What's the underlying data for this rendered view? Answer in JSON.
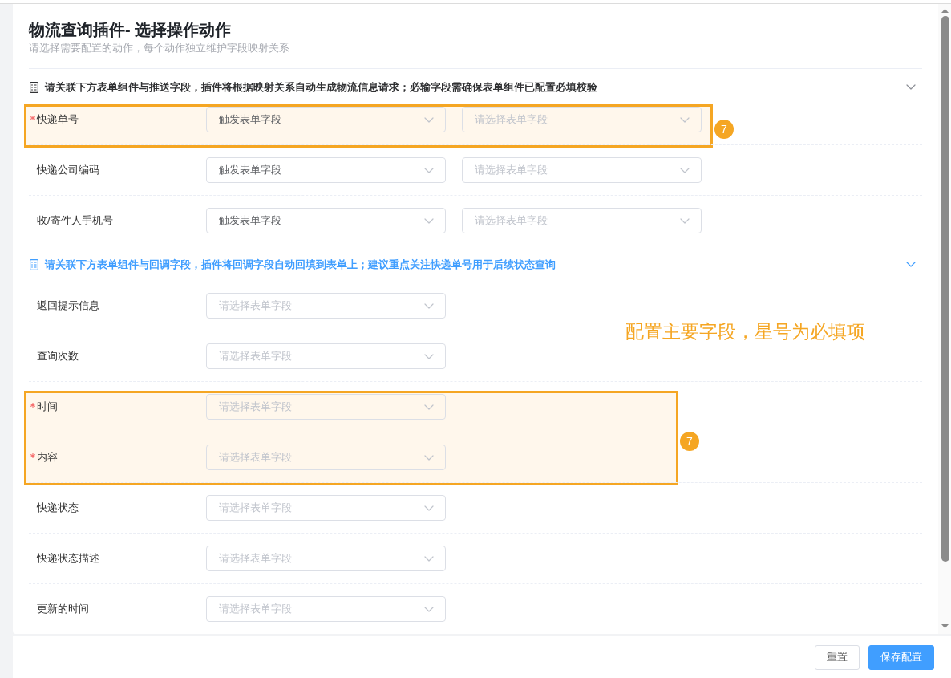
{
  "page": {
    "title": "物流查询插件- 选择操作动作",
    "subtitle": "请选择需要配置的动作，每个动作独立维护字段映射关系"
  },
  "sections": [
    {
      "title": "请关联下方表单组件与推送字段，插件将根据映射关系自动生成物流信息请求；必输字段需确保表单组件已配置必填校验",
      "active": false,
      "expanded": true,
      "badge": "7",
      "rows": [
        {
          "label": "快递单号",
          "required": true,
          "highlighted": true,
          "selects": [
            {
              "value": "触发表单字段"
            },
            {
              "placeholder": "请选择表单字段"
            }
          ]
        },
        {
          "label": "快递公司编码",
          "required": false,
          "highlighted": false,
          "selects": [
            {
              "value": "触发表单字段"
            },
            {
              "placeholder": "请选择表单字段"
            }
          ]
        },
        {
          "label": "收/寄件人手机号",
          "required": false,
          "highlighted": false,
          "selects": [
            {
              "value": "触发表单字段"
            },
            {
              "placeholder": "请选择表单字段"
            }
          ]
        }
      ]
    },
    {
      "title": "请关联下方表单组件与回调字段，插件将回调字段自动回填到表单上；建议重点关注快递单号用于后续状态查询",
      "active": true,
      "expanded": true,
      "badge": "7",
      "rows": [
        {
          "label": "返回提示信息",
          "required": false,
          "highlighted": false,
          "selects": [
            {
              "placeholder": "请选择表单字段"
            }
          ]
        },
        {
          "label": "查询次数",
          "required": false,
          "highlighted": false,
          "selects": [
            {
              "placeholder": "请选择表单字段"
            }
          ]
        },
        {
          "label": "时间",
          "required": true,
          "highlighted": true,
          "selects": [
            {
              "placeholder": "请选择表单字段"
            }
          ]
        },
        {
          "label": "内容",
          "required": true,
          "highlighted": true,
          "selects": [
            {
              "placeholder": "请选择表单字段"
            }
          ]
        },
        {
          "label": "快递状态",
          "required": false,
          "highlighted": false,
          "selects": [
            {
              "placeholder": "请选择表单字段"
            }
          ]
        },
        {
          "label": "快递状态描述",
          "required": false,
          "highlighted": false,
          "selects": [
            {
              "placeholder": "请选择表单字段"
            }
          ]
        },
        {
          "label": "更新的时间",
          "required": false,
          "highlighted": false,
          "selects": [
            {
              "placeholder": "请选择表单字段"
            }
          ]
        }
      ]
    }
  ],
  "note": "配置主要字段，星号为必填项",
  "footer": {
    "buttons": [
      {
        "label": "重置",
        "kind": "default"
      },
      {
        "label": "保存配置",
        "kind": "primary"
      }
    ]
  }
}
